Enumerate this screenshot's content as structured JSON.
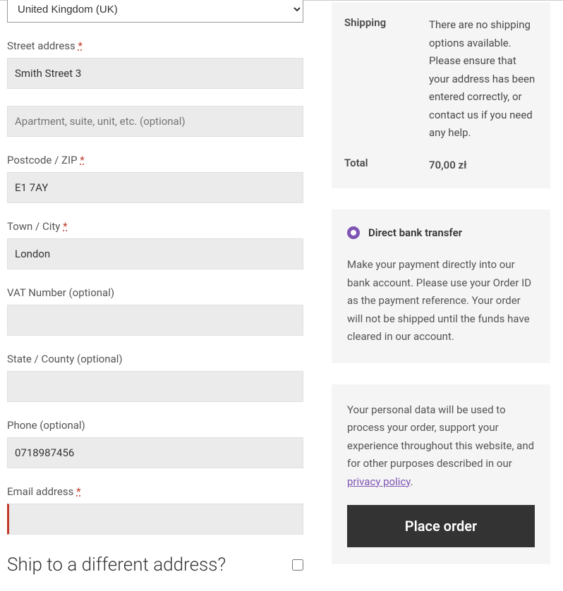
{
  "billing": {
    "country": {
      "selected": "United Kingdom (UK)"
    },
    "street": {
      "label": "Street address",
      "value": "Smith Street 3",
      "placeholder_apt": "Apartment, suite, unit, etc. (optional)"
    },
    "postcode": {
      "label": "Postcode / ZIP",
      "value": "E1 7AY"
    },
    "city": {
      "label": "Town / City",
      "value": "London"
    },
    "vat": {
      "label": "VAT Number (optional)",
      "value": ""
    },
    "state": {
      "label": "State / County (optional)",
      "value": ""
    },
    "phone": {
      "label": "Phone (optional)",
      "value": "0718987456"
    },
    "email": {
      "label": "Email address",
      "value": ""
    }
  },
  "ship_different": {
    "label": "Ship to a different address?"
  },
  "order": {
    "shipping": {
      "label": "Shipping",
      "text": "There are no shipping options available. Please ensure that your address has been entered correctly, or contact us if you need any help."
    },
    "total": {
      "label": "Total",
      "value": "70,00 zł"
    }
  },
  "payment": {
    "method_label": "Direct bank transfer",
    "description": "Make your payment directly into our bank account. Please use your Order ID as the payment reference. Your order will not be shipped until the funds have cleared in our account."
  },
  "privacy": {
    "text": "Your personal data will be used to process your order, support your experience throughout this website, and for other purposes described in our ",
    "link_text": "privacy policy"
  },
  "place_order_label": "Place order",
  "required_mark": "*"
}
